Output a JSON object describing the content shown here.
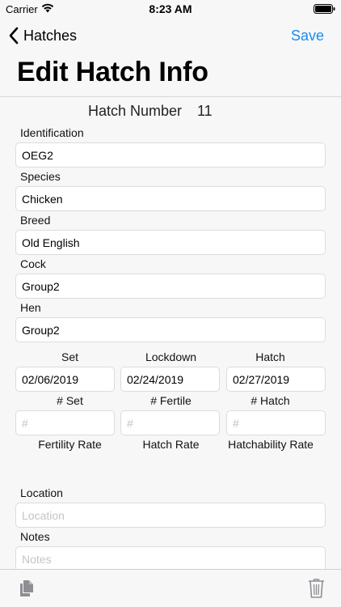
{
  "status_bar": {
    "carrier": "Carrier",
    "time": "8:23 AM"
  },
  "nav": {
    "back_label": "Hatches",
    "save_label": "Save"
  },
  "title": "Edit Hatch Info",
  "hatch_number": {
    "label": "Hatch Number",
    "value": "11"
  },
  "fields": {
    "identification": {
      "label": "Identification",
      "value": "OEG2"
    },
    "species": {
      "label": "Species",
      "value": "Chicken"
    },
    "breed": {
      "label": "Breed",
      "value": "Old English"
    },
    "cock": {
      "label": "Cock",
      "value": "Group2"
    },
    "hen": {
      "label": "Hen",
      "value": "Group2"
    }
  },
  "dates": {
    "set": {
      "label": "Set",
      "value": "02/06/2019"
    },
    "lockdown": {
      "label": "Lockdown",
      "value": "02/24/2019"
    },
    "hatch": {
      "label": "Hatch",
      "value": "02/27/2019"
    }
  },
  "counts": {
    "set": {
      "label": "# Set",
      "placeholder": "#"
    },
    "fertile": {
      "label": "# Fertile",
      "placeholder": "#"
    },
    "hatch": {
      "label": "# Hatch",
      "placeholder": "#"
    }
  },
  "rates": {
    "fertility": "Fertility Rate",
    "hatch": "Hatch Rate",
    "hatchability": "Hatchability Rate"
  },
  "location": {
    "label": "Location",
    "placeholder": "Location"
  },
  "notes": {
    "label": "Notes",
    "placeholder": "Notes"
  },
  "colors": {
    "accent": "#1a8cf0",
    "icon_gray": "#8e8e93"
  },
  "icons": {
    "back": "chevron-left",
    "copy": "copy-documents",
    "delete": "trash"
  }
}
